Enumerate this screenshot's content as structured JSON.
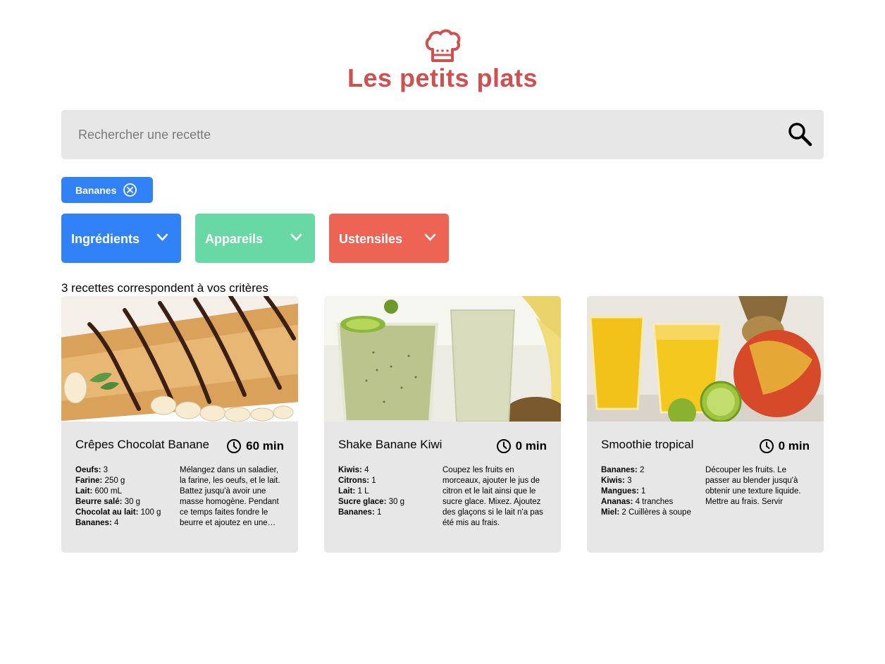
{
  "header": {
    "title": "Les petits plats",
    "logo_icon": "chef-hat-icon",
    "brand_color": "#D04F4F"
  },
  "search": {
    "placeholder": "Rechercher une recette",
    "value": "",
    "icon": "search-icon"
  },
  "tags": [
    {
      "label": "Bananes",
      "color": "#3282F7",
      "close_icon": "close-circle-icon"
    }
  ],
  "filters": [
    {
      "label": "Ingrédients",
      "color": "#3282F7",
      "icon": "chevron-down-icon"
    },
    {
      "label": "Appareils",
      "color": "#68D9A4",
      "icon": "chevron-down-icon"
    },
    {
      "label": "Ustensiles",
      "color": "#ED6454",
      "icon": "chevron-down-icon"
    }
  ],
  "results_count": "3 recettes correspondent à vos critères",
  "recipes": [
    {
      "title": "Crêpes Chocolat Banane",
      "time": "60 min",
      "ingredients": [
        {
          "name": "Oeufs:",
          "qty": "3"
        },
        {
          "name": "Farine:",
          "qty": "250 g"
        },
        {
          "name": "Lait:",
          "qty": "600 mL"
        },
        {
          "name": "Beurre salé:",
          "qty": "30 g"
        },
        {
          "name": "Chocolat au lait:",
          "qty": "100 g"
        },
        {
          "name": "Bananes:",
          "qty": "4"
        }
      ],
      "description": "Mélangez dans un saladier, la farine, les oeufs, et le lait. Battez jusqu'à avoir une masse homogène. Pendant ce temps faites fondre le beurre et ajoutez en une…"
    },
    {
      "title": "Shake Banane Kiwi",
      "time": "0 min",
      "ingredients": [
        {
          "name": "Kiwis:",
          "qty": "4"
        },
        {
          "name": "Citrons:",
          "qty": "1"
        },
        {
          "name": "Lait:",
          "qty": "1 L"
        },
        {
          "name": "Sucre glace:",
          "qty": "30 g"
        },
        {
          "name": "Bananes:",
          "qty": "1"
        }
      ],
      "description": "Coupez les fruits en morceaux, ajouter le jus de citron et le lait ainsi que le sucre glace. Mixez. Ajoutez des glaçons si le lait n'a pas été mis au frais."
    },
    {
      "title": "Smoothie tropical",
      "time": "0 min",
      "ingredients": [
        {
          "name": "Bananes:",
          "qty": "2"
        },
        {
          "name": "Kiwis:",
          "qty": "3"
        },
        {
          "name": "Mangues:",
          "qty": "1"
        },
        {
          "name": "Ananas:",
          "qty": "4 tranches"
        },
        {
          "name": "Miel:",
          "qty": "2 Cuillères à soupe"
        }
      ],
      "description": "Découper les fruits. Le passer au blender jusqu'à obtenir une texture liquide. Mettre au frais. Servir"
    }
  ]
}
